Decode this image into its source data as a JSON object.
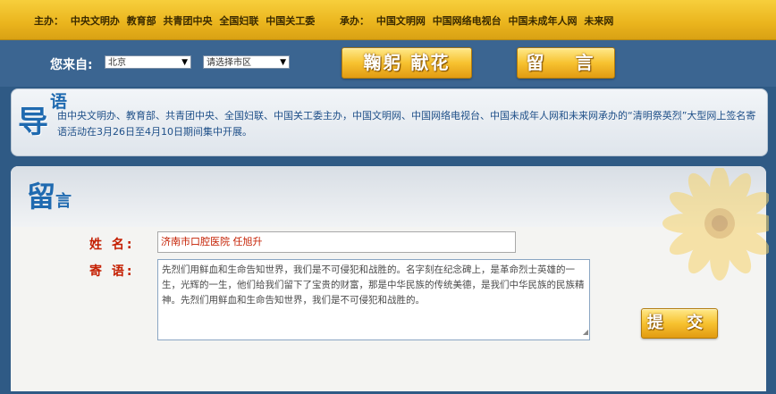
{
  "topbar": {
    "sponsor_label": "主办：",
    "sponsors": [
      "中央文明办",
      "教育部",
      "共青团中央",
      "全国妇联",
      "中国关工委"
    ],
    "organizer_label": "承办：",
    "organizers": [
      "中国文明网",
      "中国网络电视台",
      "中国未成年人网",
      "未来网"
    ]
  },
  "controls": {
    "from_label": "您来自:",
    "province": "北京",
    "city_placeholder": "请选择市区",
    "flower_button": "鞠躬 献花",
    "message_button": "留 言"
  },
  "intro": {
    "title_big": "导",
    "title_small": "语",
    "text": "由中央文明办、教育部、共青团中央、全国妇联、中国关工委主办，中国文明网、中国网络电视台、中国未成年人网和未来网承办的“清明祭英烈”大型网上签名寄语活动在3月26日至4月10日期间集中开展。"
  },
  "message": {
    "title_big": "留",
    "title_small": "言",
    "name_label": "姓 名:",
    "name_value": "济南市口腔医院   任旭升",
    "words_label": "寄 语:",
    "words_value": "先烈们用鲜血和生命告知世界，我们是不可侵犯和战胜的。名字刻在纪念碑上，是革命烈士英雄的一生，光辉的一生，他们给我们留下了宝贵的财富，那是中华民族的传统美德，是我们中华民族的民族精神。先烈们用鲜血和生命告知世界，我们是不可侵犯和战胜的。",
    "submit_button": "提 交"
  },
  "colors": {
    "gold": "#f7c230",
    "blue": "#3b6591",
    "label_red": "#c41e00",
    "title_blue": "#1f6ab0"
  },
  "icons": [
    "flower-decoration-icon",
    "dropdown-arrow-icon",
    "textarea-resize-icon"
  ]
}
